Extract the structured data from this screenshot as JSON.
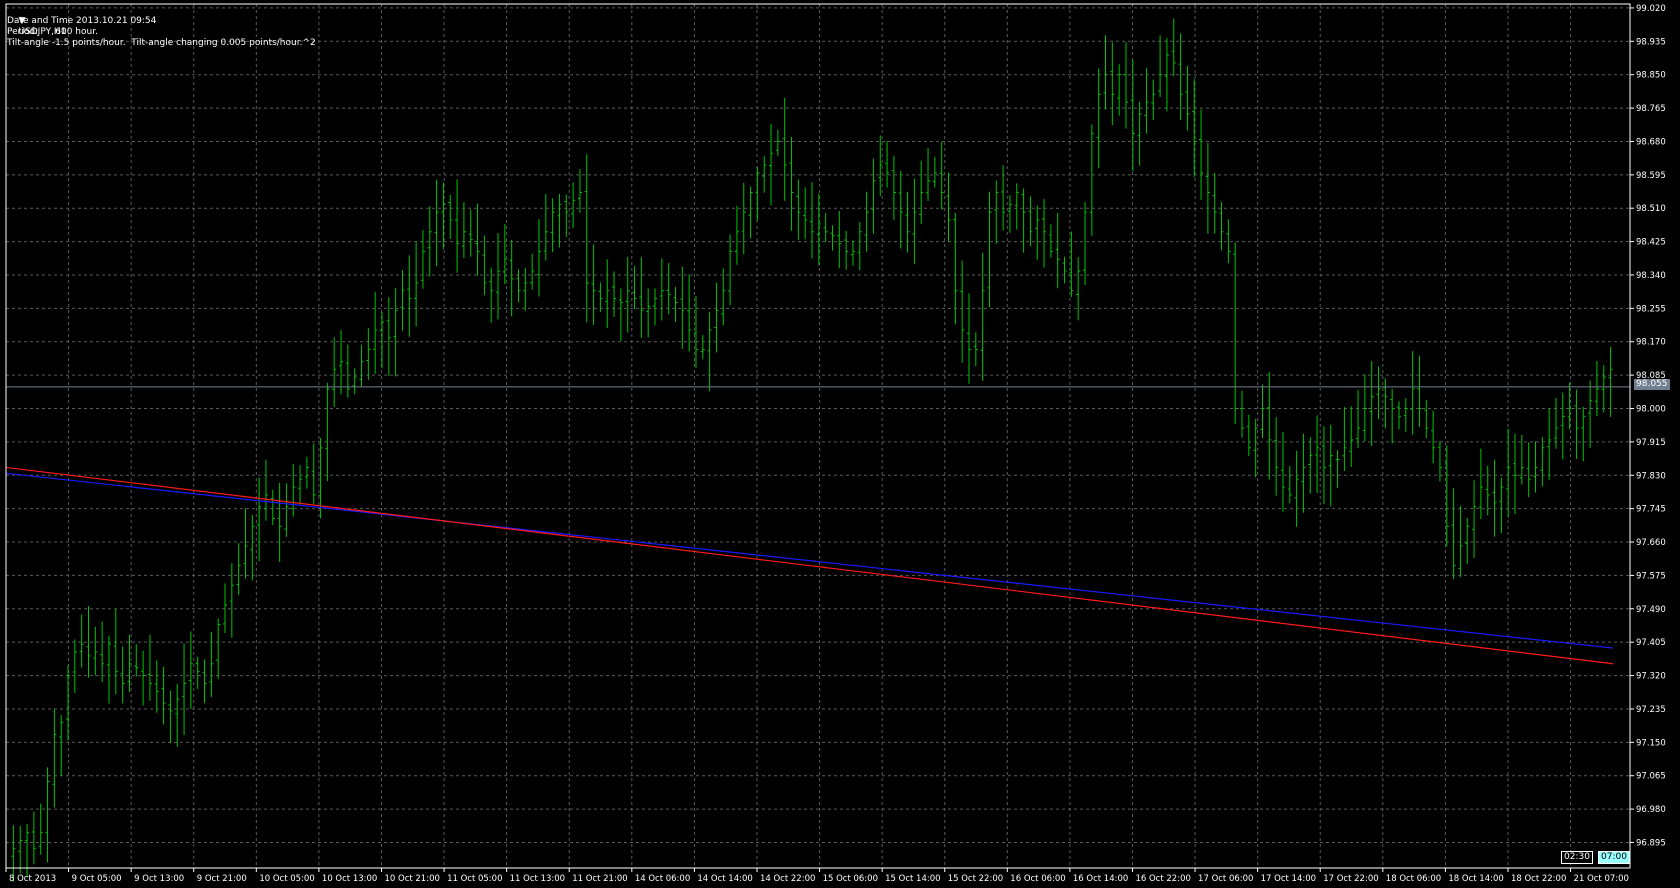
{
  "chart_window": {
    "symbol_header": "USDJPY,H1",
    "info_lines": [
      "Date and Time 2013.10.21 09:54",
      "Period:      600 hour.",
      "Tilt-angle -1.5 points/hour.  Tilt-angle changing 0.005 points/hour.^2"
    ],
    "current_price_label": "98.055",
    "countdown_boxes": [
      "02:30",
      "07:00"
    ]
  },
  "chart_data": {
    "type": "ohlc",
    "symbol": "USDJPY",
    "timeframe": "H1",
    "y_ticks": [
      "99.020",
      "98.935",
      "98.850",
      "98.765",
      "98.680",
      "98.595",
      "98.510",
      "98.425",
      "98.340",
      "98.255",
      "98.170",
      "98.085",
      "98.000",
      "97.915",
      "97.830",
      "97.745",
      "97.660",
      "97.575",
      "97.490",
      "97.405",
      "97.320",
      "97.235",
      "97.150",
      "97.065",
      "96.980",
      "96.895"
    ],
    "ylim": [
      96.83,
      99.03
    ],
    "current_price": 98.055,
    "x_ticks": [
      "8 Oct 2013",
      "9 Oct 05:00",
      "9 Oct 13:00",
      "9 Oct 21:00",
      "10 Oct 05:00",
      "10 Oct 13:00",
      "10 Oct 21:00",
      "11 Oct 05:00",
      "11 Oct 13:00",
      "11 Oct 21:00",
      "14 Oct 06:00",
      "14 Oct 14:00",
      "14 Oct 22:00",
      "15 Oct 06:00",
      "15 Oct 14:00",
      "15 Oct 22:00",
      "16 Oct 06:00",
      "16 Oct 14:00",
      "16 Oct 22:00",
      "17 Oct 06:00",
      "17 Oct 14:00",
      "17 Oct 22:00",
      "18 Oct 06:00",
      "18 Oct 14:00",
      "18 Oct 22:00",
      "21 Oct 07:00"
    ],
    "bar_count": 250,
    "closes": [
      96.88,
      96.9,
      96.92,
      96.88,
      96.92,
      97.05,
      97.17,
      97.2,
      97.32,
      97.38,
      97.4,
      97.37,
      97.38,
      97.35,
      97.4,
      97.33,
      97.3,
      97.35,
      97.34,
      97.32,
      97.3,
      97.28,
      97.25,
      97.23,
      97.26,
      97.3,
      97.35,
      97.33,
      97.3,
      97.35,
      97.45,
      97.5,
      97.55,
      97.6,
      97.65,
      97.7,
      97.75,
      97.78,
      97.72,
      97.7,
      97.75,
      97.8,
      97.82,
      97.85,
      97.78,
      97.9,
      98.05,
      98.1,
      98.12,
      98.05,
      98.08,
      98.12,
      98.15,
      98.2,
      98.22,
      98.18,
      98.25,
      98.3,
      98.28,
      98.32,
      98.4,
      98.45,
      98.5,
      98.52,
      98.48,
      98.42,
      98.45,
      98.43,
      98.4,
      98.32,
      98.3,
      98.35,
      98.38,
      98.33,
      98.3,
      98.32,
      98.35,
      98.4,
      98.45,
      98.5,
      98.52,
      98.5,
      98.53,
      98.55,
      98.32,
      98.3,
      98.28,
      98.3,
      98.28,
      98.27,
      98.3,
      98.28,
      98.25,
      98.26,
      98.28,
      98.3,
      98.29,
      98.27,
      98.25,
      98.2,
      98.15,
      98.15,
      98.2,
      98.25,
      98.3,
      98.4,
      98.45,
      98.5,
      98.55,
      98.6,
      98.62,
      98.65,
      98.68,
      98.62,
      98.55,
      98.5,
      98.48,
      98.45,
      98.47,
      98.45,
      98.44,
      98.42,
      98.4,
      98.4,
      98.45,
      98.5,
      98.58,
      98.62,
      98.6,
      98.55,
      98.5,
      98.45,
      98.5,
      98.55,
      98.58,
      98.6,
      98.55,
      98.48,
      98.3,
      98.2,
      98.15,
      98.15,
      98.3,
      98.5,
      98.55,
      98.5,
      98.52,
      98.55,
      98.5,
      98.45,
      98.48,
      98.45,
      98.4,
      98.38,
      98.35,
      98.3,
      98.35,
      98.5,
      98.7,
      98.8,
      98.85,
      98.8,
      98.85,
      98.78,
      98.7,
      98.75,
      98.78,
      98.8,
      98.85,
      98.9,
      98.88,
      98.8,
      98.75,
      98.68,
      98.6,
      98.55,
      98.5,
      98.45,
      98.4,
      98.0,
      97.95,
      97.9,
      97.95,
      98.0,
      97.92,
      97.85,
      97.8,
      97.78,
      97.82,
      97.85,
      97.88,
      97.9,
      97.85,
      97.88,
      97.87,
      97.9,
      97.92,
      97.95,
      98.0,
      98.03,
      98.05,
      98.03,
      98.0,
      97.98,
      98.0,
      98.05,
      98.0,
      97.95,
      97.9,
      97.85,
      97.7,
      97.6,
      97.65,
      97.7,
      97.75,
      97.8,
      97.78,
      97.76,
      97.8,
      97.85,
      97.83,
      97.85,
      97.82,
      97.85,
      97.9,
      97.92,
      97.95,
      97.98,
      98.0,
      97.95,
      97.98,
      98.02,
      98.05,
      98.08,
      98.1
    ],
    "line_red": {
      "start": 97.85,
      "end": 97.35
    },
    "line_blue": {
      "start": 97.835,
      "end": 97.39
    },
    "colors": {
      "background": "#000000",
      "grid": "#5a5a5a",
      "bars": "#00c400",
      "line_red": "#ff1a1a",
      "line_blue": "#1a1aff",
      "text": "#ffffff",
      "price_line": "#708090"
    }
  }
}
